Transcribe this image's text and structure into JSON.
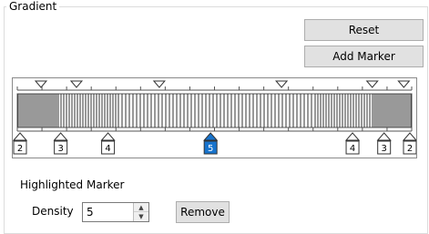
{
  "group": {
    "title": "Gradient"
  },
  "buttons": {
    "reset": "Reset",
    "add_marker": "Add Marker",
    "remove": "Remove"
  },
  "markers_top": [
    0.06,
    0.15,
    0.36,
    0.67,
    0.9,
    0.98
  ],
  "markers_bottom": [
    {
      "label": "2",
      "pos": 0.0,
      "highlighted": false
    },
    {
      "label": "3",
      "pos": 0.11,
      "highlighted": false
    },
    {
      "label": "4",
      "pos": 0.23,
      "highlighted": false
    },
    {
      "label": "5",
      "pos": 0.49,
      "highlighted": true
    },
    {
      "label": "4",
      "pos": 0.85,
      "highlighted": false
    },
    {
      "label": "3",
      "pos": 0.93,
      "highlighted": false
    },
    {
      "label": "2",
      "pos": 1.0,
      "highlighted": false
    }
  ],
  "highlighted": {
    "title": "Highlighted Marker",
    "density_label": "Density",
    "density_value": "5"
  },
  "colors": {
    "highlight": "#1874cd"
  },
  "icons": {
    "spin_up": "triangle-up-icon",
    "spin_down": "triangle-down-icon"
  }
}
